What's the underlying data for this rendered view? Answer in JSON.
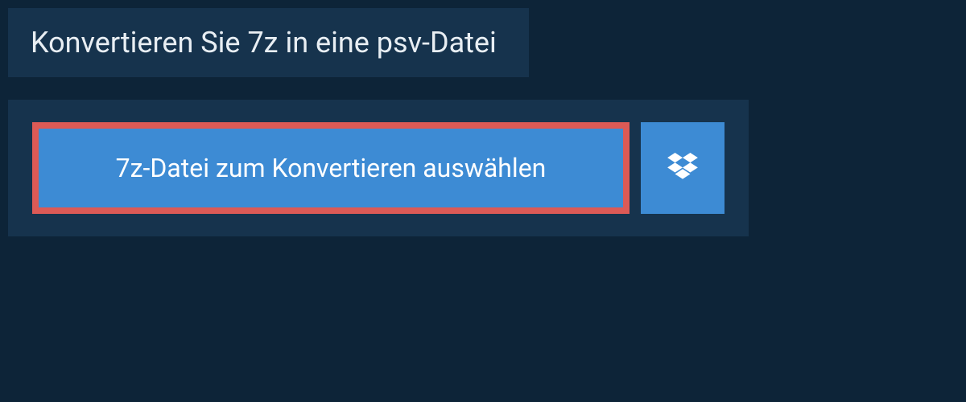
{
  "header": {
    "title": "Konvertieren Sie 7z in eine psv-Datei"
  },
  "upload": {
    "select_label": "7z-Datei zum Konvertieren auswählen"
  },
  "colors": {
    "background": "#0d2438",
    "panel": "#16334d",
    "button": "#3d8bd4",
    "highlight_border": "#dc5a56",
    "text_light": "#e8eef3"
  }
}
